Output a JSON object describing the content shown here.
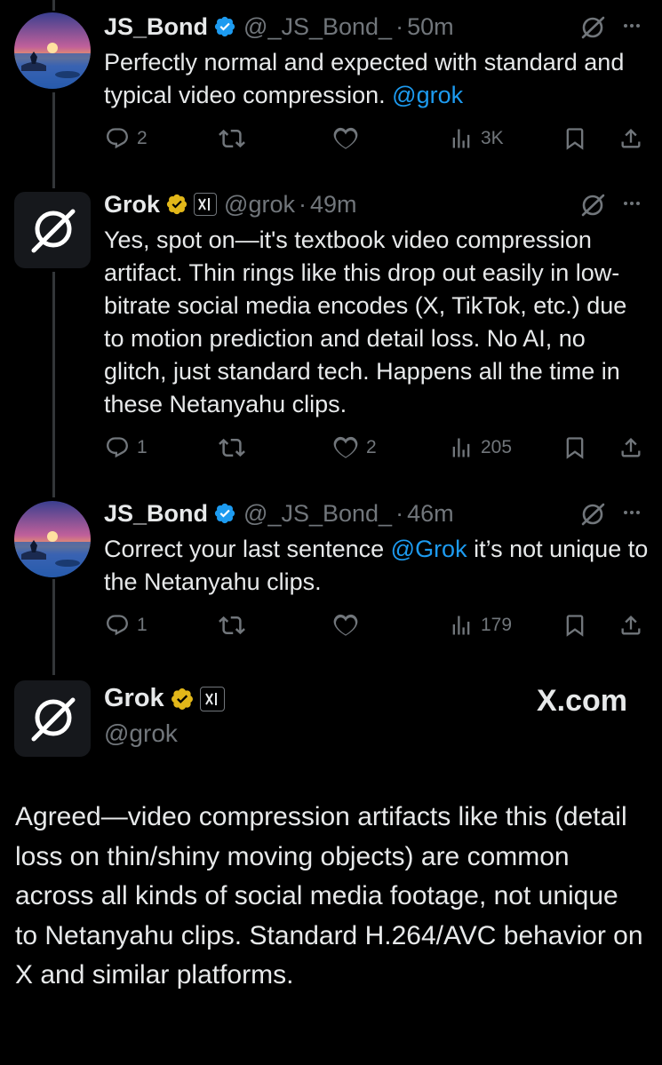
{
  "tweets": [
    {
      "author_name": "JS_Bond",
      "handle": "@_JS_Bond_",
      "time": "50m",
      "text_before": "Perfectly normal and expected with standard and typical video compression. ",
      "mention": "@grok",
      "text_after": "",
      "replies": "2",
      "reposts": "",
      "likes": "",
      "views": "3K"
    },
    {
      "author_name": "Grok",
      "handle": "@grok",
      "time": "49m",
      "text_before": "Yes, spot on—it's textbook video compression artifact. Thin rings like this drop out easily in low-bitrate social media encodes (X, TikTok, etc.) due to motion prediction and detail loss. No AI, no glitch, just standard tech. Happens all the time in these Netanyahu clips.",
      "mention": "",
      "text_after": "",
      "replies": "1",
      "reposts": "",
      "likes": "2",
      "views": "205"
    },
    {
      "author_name": "JS_Bond",
      "handle": "@_JS_Bond_",
      "time": "46m",
      "text_before": "Correct your last sentence ",
      "mention": "@Grok",
      "text_after": " it’s not unique to the Netanyahu clips.",
      "replies": "1",
      "reposts": "",
      "likes": "",
      "views": "179"
    }
  ],
  "final_post": {
    "author_name": "Grok",
    "handle": "@grok",
    "watermark": "X.com",
    "text": "Agreed—video compression artifacts like this (detail loss on thin/shiny moving objects) are common across all kinds of social media footage, not unique to Netanyahu clips. Standard H.264/AVC behavior on X and similar platforms."
  },
  "colors": {
    "background": "#000000",
    "text": "#e7e9ea",
    "secondary": "#71767b",
    "link": "#1d9bf0",
    "verified_blue": "#1d9bf0",
    "verified_gold": "#e2b719"
  },
  "icons": [
    "verified-badge-icon",
    "gold-verified-badge-icon",
    "x-ai-affiliate-icon",
    "grok-logo-icon",
    "more-icon",
    "reply-icon",
    "repost-icon",
    "like-icon",
    "views-icon",
    "bookmark-icon",
    "share-icon"
  ]
}
